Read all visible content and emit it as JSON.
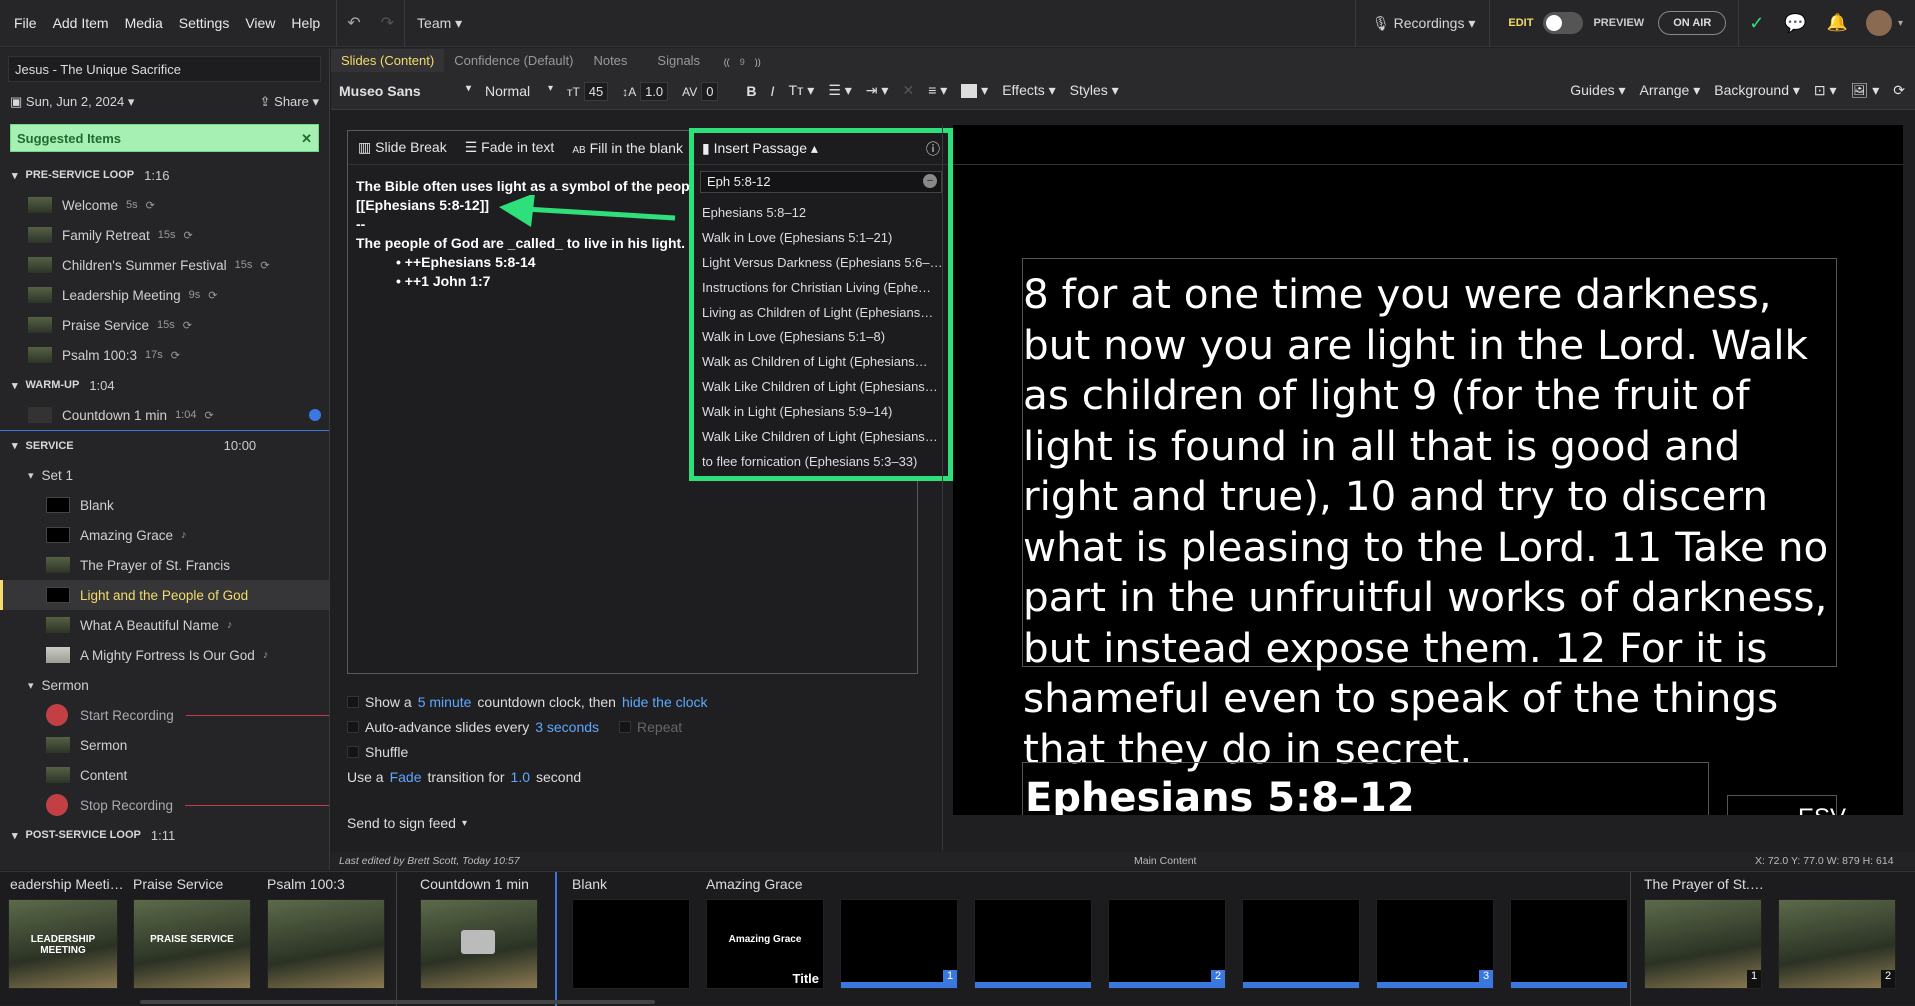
{
  "menubar": {
    "items": [
      "File",
      "Add Item",
      "Media",
      "Settings",
      "View",
      "Help"
    ],
    "team": "Team",
    "recordings": "Recordings",
    "edit": "EDIT",
    "preview": "PREVIEW",
    "on_air": "ON AIR"
  },
  "sidebar": {
    "plan_title": "Jesus - The Unique Sacrifice",
    "date": "Sun, Jun 2, 2024",
    "share": "Share",
    "suggested": "Suggested Items",
    "sections": [
      {
        "name": "PRE-SERVICE LOOP",
        "len": "1:16"
      },
      {
        "name": "WARM-UP",
        "len": "1:04"
      },
      {
        "name": "SERVICE",
        "len": "10:00"
      },
      {
        "name": "POST-SERVICE LOOP",
        "len": "1:11"
      }
    ],
    "pre_items": [
      {
        "label": "Welcome",
        "dur": "5s"
      },
      {
        "label": "Family Retreat",
        "dur": "15s"
      },
      {
        "label": "Children's Summer Festival",
        "dur": "15s"
      },
      {
        "label": "Leadership Meeting",
        "dur": "9s"
      },
      {
        "label": "Praise Service",
        "dur": "15s"
      },
      {
        "label": "Psalm 100:3",
        "dur": "17s"
      }
    ],
    "warm_item": {
      "label": "Countdown 1 min",
      "dur": "1:04"
    },
    "set1": "Set 1",
    "set1_items": [
      "Blank",
      "Amazing Grace",
      "The Prayer of St. Francis",
      "Light and the People of God",
      "What A Beautiful Name",
      "A Mighty Fortress Is Our God"
    ],
    "sermon": "Sermon",
    "sermon_items": [
      "Start Recording",
      "Sermon",
      "Content",
      "Stop Recording"
    ]
  },
  "tabs": [
    "Slides (Content)",
    "Confidence (Default)",
    "Notes",
    "Signals"
  ],
  "signals_count": "9",
  "toolbar": {
    "font": "Museo Sans",
    "weight": "Normal",
    "size": "45",
    "line": "1.0",
    "spacing": "0",
    "effects": "Effects",
    "styles": "Styles",
    "guides": "Guides",
    "arrange": "Arrange",
    "background": "Background"
  },
  "panel": {
    "slide_break": "Slide Break",
    "fade_in_text": "Fade in text",
    "fill_blank": "Fill in the blank",
    "line1": "The Bible often uses light as a symbol of the people o",
    "line2": "[[Ephesians 5:8-12]]",
    "line3": "--",
    "line4": "The people of God are _called_ to live in his light.",
    "bullet1": "++Ephesians 5:8-14",
    "bullet2": "++1 John 1:7"
  },
  "passage": {
    "title": "Insert Passage",
    "query": "Eph 5:8-12",
    "results": [
      "Ephesians 5:8–12",
      "Walk in Love (Ephesians 5:1–21)",
      "Light Versus Darkness (Ephesians 5:6–…",
      "Instructions for Christian Living (Ephe…",
      "Living as Children of Light (Ephesians…",
      "Walk in Love (Ephesians 5:1–8)",
      "Walk as Children of Light (Ephesians…",
      "Walk Like Children of Light (Ephesians…",
      "Walk in Light (Ephesians 5:9–14)",
      "Walk Like Children of Light (Ephesians…",
      "to flee fornication (Ephesians 5:3–33)"
    ]
  },
  "options": {
    "show_a": "Show a",
    "five_minute": "5 minute",
    "countdown": "countdown clock, then",
    "hide_clock": "hide the clock",
    "auto_advance": "Auto-advance slides every",
    "three_seconds": "3 seconds",
    "repeat": "Repeat",
    "shuffle": "Shuffle",
    "use_a": "Use a",
    "fade": "Fade",
    "transition_for": "transition for",
    "one_zero": "1.0",
    "second": "second",
    "send": "Send to sign feed"
  },
  "preview": {
    "text": "8 for at one time you were darkness, but now you are light in the Lord. Walk as children of light 9 (for the fruit of light is found in all that is good and right and true), 10 and try to discern what is pleasing to the Lord. 11 Take no part in the unfruitful works of darkness, but instead expose them. 12 For it is shameful even to speak of the things that they do in secret.",
    "ref": "Ephesians 5:8–12",
    "esv": "ESV"
  },
  "status": {
    "edited": "Last edited by Brett Scott, Today 10:57",
    "main": "Main Content",
    "coords": "X: 72.0  Y: 77.0  W: 879  H: 614"
  },
  "filmstrip": {
    "labels": [
      "eadership Meeti…",
      "Praise Service",
      "Psalm 100:3",
      "Countdown 1 min",
      "Blank",
      "Amazing Grace",
      "The Prayer of St.…"
    ],
    "thumb_texts": {
      "leadership": "LEADERSHIP MEETING",
      "praise": "PRAISE SERVICE",
      "amazing": "Amazing Grace",
      "title": "Title"
    },
    "numbers": [
      "1",
      "2",
      "3",
      "1",
      "2"
    ]
  }
}
